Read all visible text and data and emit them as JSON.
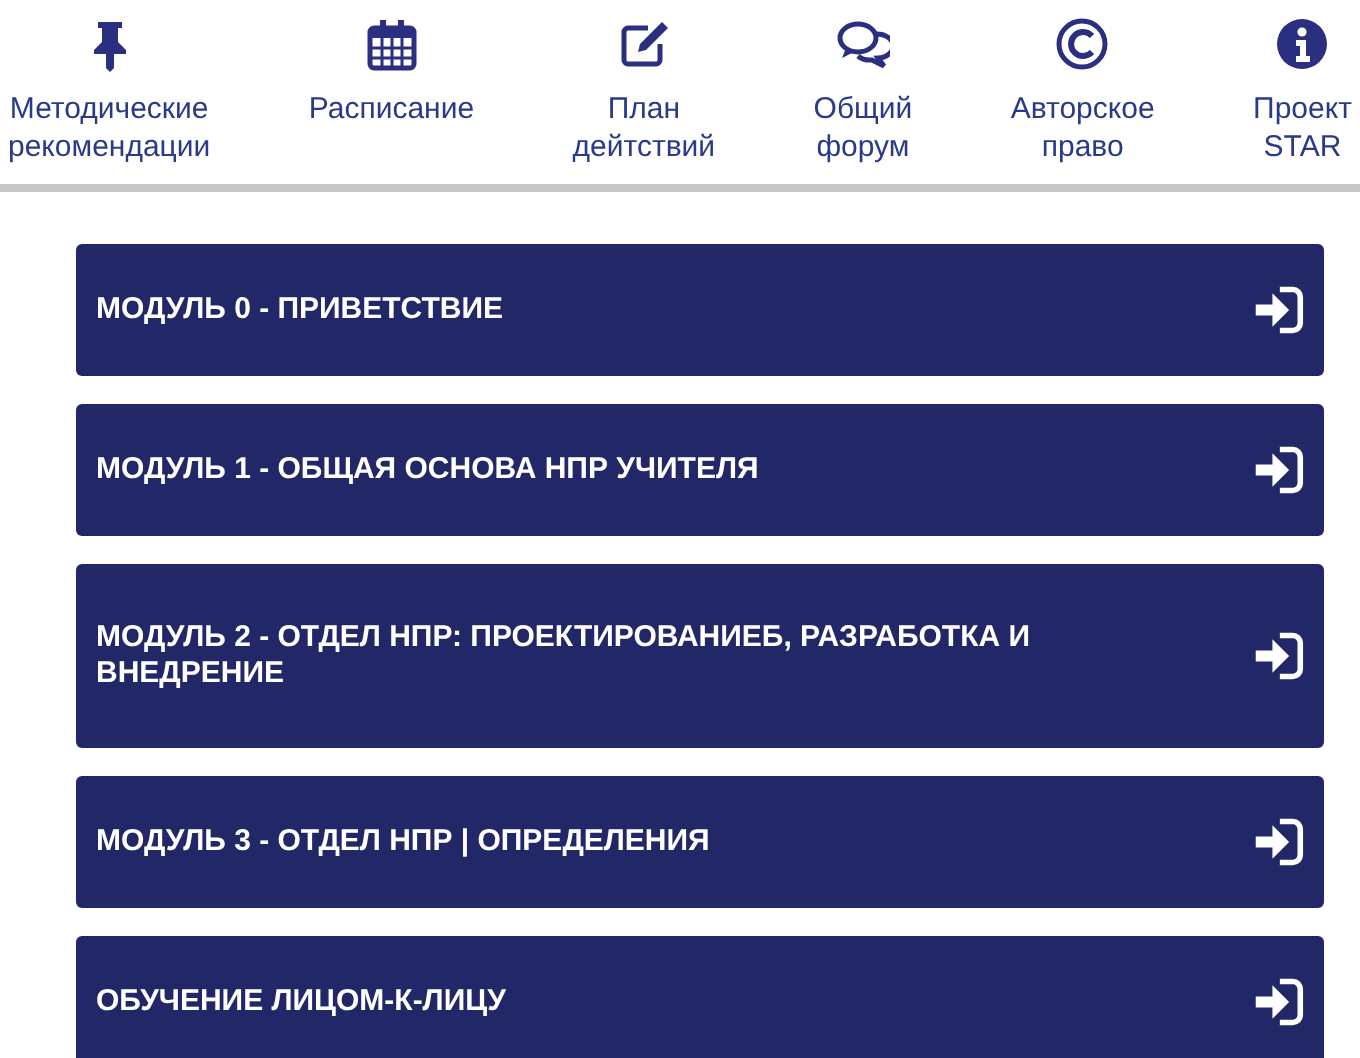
{
  "nav_items": [
    {
      "kind": "pin",
      "label": "Методические рекомендации"
    },
    {
      "kind": "calendar",
      "label": "Расписание"
    },
    {
      "kind": "edit",
      "label": "План дейтствий"
    },
    {
      "kind": "chat",
      "label": "Общий форум"
    },
    {
      "kind": "copyright",
      "label": "Авторское право"
    },
    {
      "kind": "info",
      "label": "Проект STAR"
    }
  ],
  "modules": [
    {
      "label": "МОДУЛЬ 0 - ПРИВЕТСТВИЕ"
    },
    {
      "label": "МОДУЛЬ 1 - ОБЩАЯ ОСНОВА НПР УЧИТЕЛЯ"
    },
    {
      "label": "МОДУЛЬ 2 - ОТДЕЛ НПР: ПРОЕКТИРОВАНИЕБ, РАЗРАБОТКА И ВНЕДРЕНИЕ"
    },
    {
      "label": "МОДУЛЬ 3 - ОТДЕЛ НПР | ОПРЕДЕЛЕНИЯ"
    },
    {
      "label": "ОБУЧЕНИЕ ЛИЦОМ-К-ЛИЦУ"
    }
  ]
}
